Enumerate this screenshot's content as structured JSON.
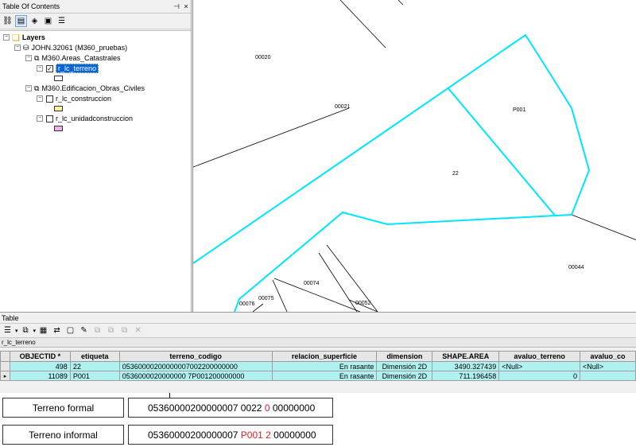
{
  "toc": {
    "title": "Table Of Contents",
    "pin": "₽",
    "close": "×",
    "root": "Layers",
    "db": "JOHN.32061 (M360_pruebas)",
    "groups": [
      {
        "name": "M360.Areas_Catastrales"
      },
      {
        "name": "M360.Edificacion_Obras_Civiles"
      }
    ],
    "layers": [
      {
        "name": "r_lc_terreno",
        "checked": true,
        "color": "#ffffff"
      },
      {
        "name": "r_lc_construccion",
        "checked": false,
        "color": "#fff0a0"
      },
      {
        "name": "r_lc_unidadconstruccion",
        "checked": false,
        "color": "#f0b0f0"
      }
    ]
  },
  "map": {
    "parcel_labels": [
      "00020",
      "00021",
      "P001",
      "22",
      "00044",
      "00074",
      "00075",
      "00052",
      "00076"
    ],
    "highlight_color": "#00e5ff"
  },
  "table": {
    "window_title": "Table",
    "tab": "r_lc_terreno",
    "columns": [
      "OBJECTID *",
      "etiqueta",
      "terreno_codigo",
      "relacion_superficie",
      "dimension",
      "SHAPE.AREA",
      "avaluo_terreno",
      "avaluo_co"
    ],
    "rows": [
      {
        "objectid": "498",
        "etiqueta": "22",
        "codigo": "05360000200000007002200000000",
        "relacion": "En rasante",
        "dimension": "Dimensión 2D",
        "area": "3490.327439",
        "avaluo": "<Null>",
        "avaluo_co": "<Null>"
      },
      {
        "objectid": "11089",
        "etiqueta": "P001",
        "codigo": "0536000020000000 7P001200000000",
        "relacion": "En rasante",
        "dimension": "Dimensión 2D",
        "area": "711.196458",
        "avaluo": "0",
        "avaluo_co": ""
      }
    ]
  },
  "annotations": {
    "formal_label": "Terreno formal",
    "formal_a": "05360000200000007 0022 ",
    "formal_red": "0",
    "formal_b": " 00000000",
    "informal_label": "Terreno informal",
    "informal_a": "05360000200000007 ",
    "informal_red": "P001 2",
    "informal_b": " 00000000"
  }
}
